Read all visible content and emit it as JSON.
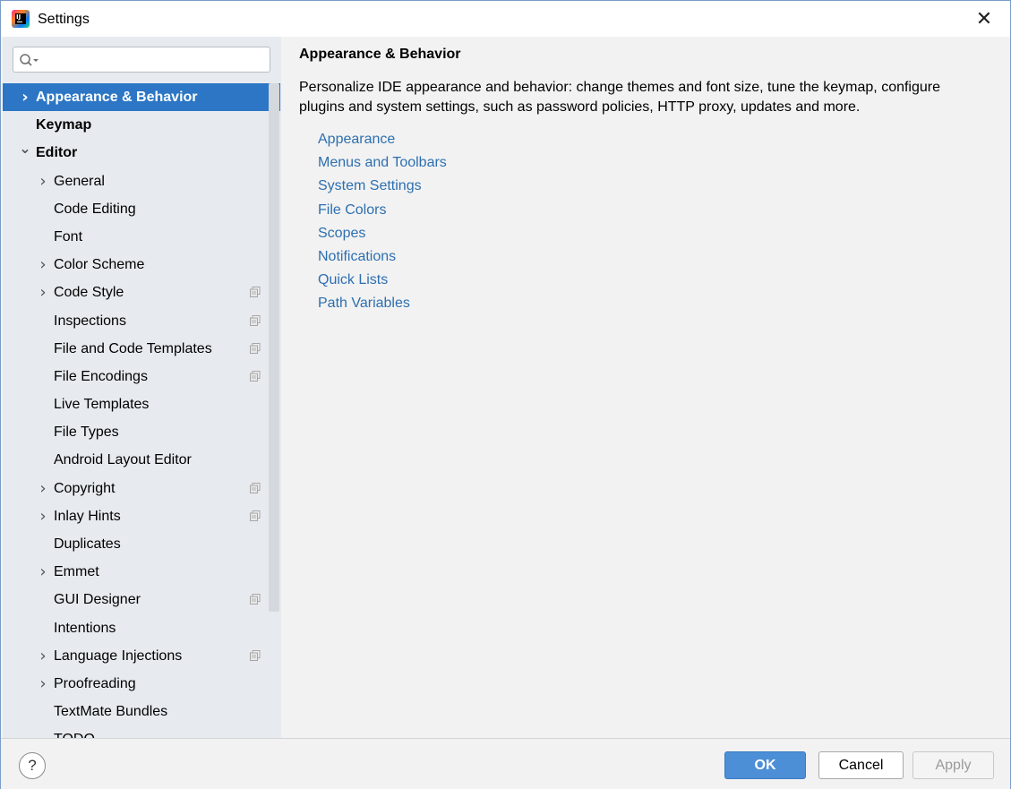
{
  "window": {
    "title": "Settings"
  },
  "sidebar": {
    "search_placeholder": "",
    "items": [
      {
        "label": "Appearance & Behavior",
        "level": 0,
        "arrow": "right",
        "bold": true,
        "selected": true,
        "copy": false
      },
      {
        "label": "Keymap",
        "level": 0,
        "arrow": "none",
        "bold": true,
        "selected": false,
        "copy": false
      },
      {
        "label": "Editor",
        "level": 0,
        "arrow": "down",
        "bold": true,
        "selected": false,
        "copy": false
      },
      {
        "label": "General",
        "level": 1,
        "arrow": "right",
        "bold": false,
        "selected": false,
        "copy": false
      },
      {
        "label": "Code Editing",
        "level": 1,
        "arrow": "none",
        "bold": false,
        "selected": false,
        "copy": false
      },
      {
        "label": "Font",
        "level": 1,
        "arrow": "none",
        "bold": false,
        "selected": false,
        "copy": false
      },
      {
        "label": "Color Scheme",
        "level": 1,
        "arrow": "right",
        "bold": false,
        "selected": false,
        "copy": false
      },
      {
        "label": "Code Style",
        "level": 1,
        "arrow": "right",
        "bold": false,
        "selected": false,
        "copy": true
      },
      {
        "label": "Inspections",
        "level": 1,
        "arrow": "none",
        "bold": false,
        "selected": false,
        "copy": true
      },
      {
        "label": "File and Code Templates",
        "level": 1,
        "arrow": "none",
        "bold": false,
        "selected": false,
        "copy": true
      },
      {
        "label": "File Encodings",
        "level": 1,
        "arrow": "none",
        "bold": false,
        "selected": false,
        "copy": true
      },
      {
        "label": "Live Templates",
        "level": 1,
        "arrow": "none",
        "bold": false,
        "selected": false,
        "copy": false
      },
      {
        "label": "File Types",
        "level": 1,
        "arrow": "none",
        "bold": false,
        "selected": false,
        "copy": false
      },
      {
        "label": "Android Layout Editor",
        "level": 1,
        "arrow": "none",
        "bold": false,
        "selected": false,
        "copy": false
      },
      {
        "label": "Copyright",
        "level": 1,
        "arrow": "right",
        "bold": false,
        "selected": false,
        "copy": true
      },
      {
        "label": "Inlay Hints",
        "level": 1,
        "arrow": "right",
        "bold": false,
        "selected": false,
        "copy": true
      },
      {
        "label": "Duplicates",
        "level": 1,
        "arrow": "none",
        "bold": false,
        "selected": false,
        "copy": false
      },
      {
        "label": "Emmet",
        "level": 1,
        "arrow": "right",
        "bold": false,
        "selected": false,
        "copy": false
      },
      {
        "label": "GUI Designer",
        "level": 1,
        "arrow": "none",
        "bold": false,
        "selected": false,
        "copy": true
      },
      {
        "label": "Intentions",
        "level": 1,
        "arrow": "none",
        "bold": false,
        "selected": false,
        "copy": false
      },
      {
        "label": "Language Injections",
        "level": 1,
        "arrow": "right",
        "bold": false,
        "selected": false,
        "copy": true
      },
      {
        "label": "Proofreading",
        "level": 1,
        "arrow": "right",
        "bold": false,
        "selected": false,
        "copy": false
      },
      {
        "label": "TextMate Bundles",
        "level": 1,
        "arrow": "none",
        "bold": false,
        "selected": false,
        "copy": false
      },
      {
        "label": "TODO",
        "level": 1,
        "arrow": "none",
        "bold": false,
        "selected": false,
        "copy": false
      }
    ]
  },
  "content": {
    "title": "Appearance & Behavior",
    "description": "Personalize IDE appearance and behavior: change themes and font size, tune the keymap, configure plugins and system settings, such as password policies, HTTP proxy, updates and more.",
    "links": [
      "Appearance",
      "Menus and Toolbars",
      "System Settings",
      "File Colors",
      "Scopes",
      "Notifications",
      "Quick Lists",
      "Path Variables"
    ]
  },
  "footer": {
    "help_label": "?",
    "ok_label": "OK",
    "cancel_label": "Cancel",
    "apply_label": "Apply"
  },
  "colors": {
    "selection": "#2c76c5",
    "link": "#2d6fb0",
    "ok_button": "#4c8fd6"
  }
}
